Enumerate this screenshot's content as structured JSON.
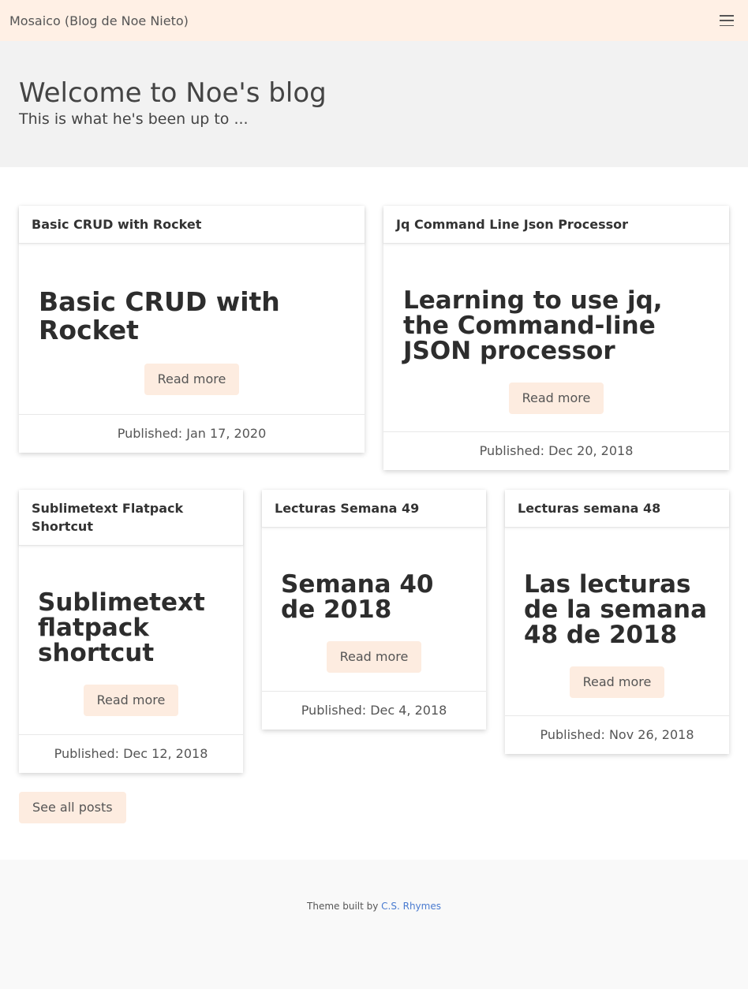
{
  "navbar": {
    "brand": "Mosaico (Blog de Noe Nieto)",
    "menu_icon": "hamburger-menu-icon"
  },
  "hero": {
    "title": "Welcome to Noe's blog",
    "subtitle": "This is what he's been up to ..."
  },
  "posts": [
    {
      "header": "Basic CRUD with Rocket",
      "title": "Basic CRUD with Rocket",
      "read_more": "Read more",
      "published": "Published: Jan 17, 2020"
    },
    {
      "header": "Jq Command Line Json Processor",
      "title": "Learning to use jq, the Command-line JSON processor",
      "read_more": "Read more",
      "published": "Published: Dec 20, 2018"
    },
    {
      "header": "Sublimetext Flatpack Shortcut",
      "title": "Sublimetext flatpack shortcut",
      "read_more": "Read more",
      "published": "Published: Dec 12, 2018"
    },
    {
      "header": "Lecturas Semana 49",
      "title": "Semana 40 de 2018",
      "read_more": "Read more",
      "published": "Published: Dec 4, 2018"
    },
    {
      "header": "Lecturas semana 48",
      "title": "Las lecturas de la semana 48 de 2018",
      "read_more": "Read more",
      "published": "Published: Nov 26, 2018"
    }
  ],
  "see_all": "See all posts",
  "footer": {
    "prefix": "Theme built by ",
    "link": "C.S. Rhymes"
  },
  "colors": {
    "navbar_bg": "#fff0e5",
    "button_bg": "#fdece0",
    "link": "#4a7bd0"
  }
}
